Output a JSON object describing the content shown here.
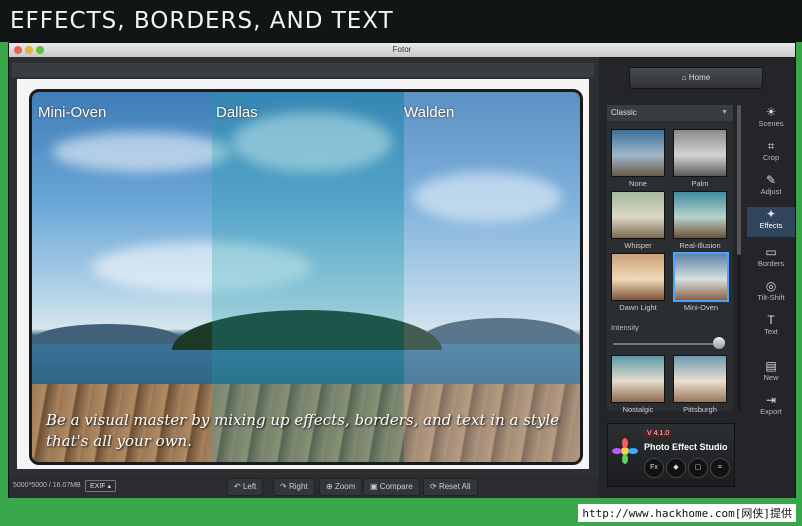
{
  "banner": {
    "title": "EFFECTS, BORDERS, AND TEXT"
  },
  "window": {
    "title": "Fotor"
  },
  "canvas": {
    "effect_labels": [
      "Mini-Oven",
      "Dallas",
      "Walden"
    ],
    "caption": "Be a visual master by mixing up effects, borders, and text in a style that's all your own."
  },
  "status": {
    "dimensions": "5000*5000 / 16.07MB",
    "exif": "EXIF ▴",
    "buttons": {
      "left": "Left",
      "right": "Right",
      "zoom": "Zoom",
      "compare": "Compare",
      "reset": "Reset All"
    }
  },
  "sidebar": {
    "home_label": "Home",
    "category": "Classic",
    "effects": [
      {
        "label": "None"
      },
      {
        "label": "Palm"
      },
      {
        "label": "Whisper"
      },
      {
        "label": "Real-Illusion"
      },
      {
        "label": "Dawn Light"
      },
      {
        "label": "Mini-Oven"
      },
      {
        "label": "Nostalgic"
      },
      {
        "label": "Pittsburgh"
      }
    ],
    "intensity_label": "Intensity",
    "intensity_value": 1.0,
    "tools": [
      {
        "label": "Scenes",
        "icon": "sun-icon"
      },
      {
        "label": "Crop",
        "icon": "crop-icon"
      },
      {
        "label": "Adjust",
        "icon": "pencil-icon"
      },
      {
        "label": "Effects",
        "icon": "sparkle-icon",
        "active": true
      },
      {
        "label": "Borders",
        "icon": "frame-icon"
      },
      {
        "label": "Tilt-Shift",
        "icon": "target-icon"
      },
      {
        "label": "Text",
        "icon": "text-icon"
      },
      {
        "label": "New",
        "icon": "new-file-icon"
      },
      {
        "label": "Export",
        "icon": "export-icon"
      }
    ]
  },
  "promo": {
    "version": "V 4.1.0",
    "name": "Photo Effect Studio",
    "fx": "Fx"
  },
  "watermark": "http://www.hackhome.com[网侠]提供"
}
